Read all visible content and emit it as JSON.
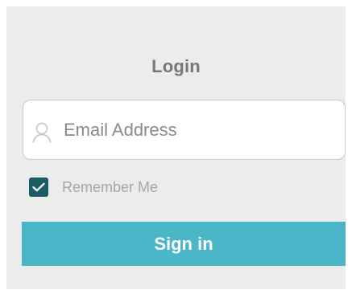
{
  "login": {
    "title": "Login",
    "email_placeholder": "Email Address",
    "email_value": "",
    "remember_me_label": "Remember Me",
    "remember_me_checked": true,
    "signin_label": "Sign in"
  },
  "icons": {
    "email_field_icon": "user-icon",
    "checkbox_icon": "checkmark-icon"
  },
  "colors": {
    "background": "#ececec",
    "button_bg": "#4bb6c8",
    "checkbox_bg": "#1b5c66",
    "title_text": "#777777"
  }
}
